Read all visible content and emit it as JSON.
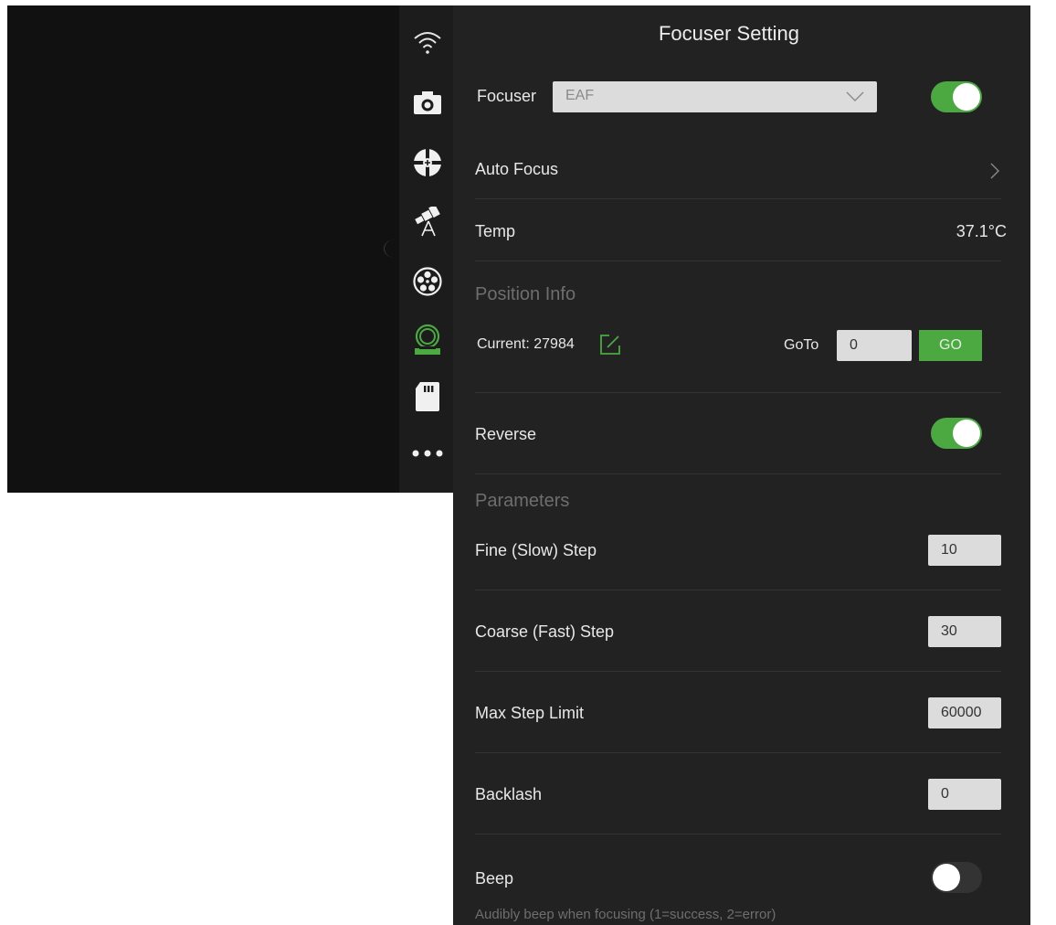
{
  "panel": {
    "title": "Focuser Setting",
    "focuser": {
      "label": "Focuser",
      "selected": "EAF",
      "enabled": true
    },
    "auto_focus": {
      "label": "Auto Focus"
    },
    "temp": {
      "label": "Temp",
      "value": "37.1°C"
    },
    "position_info": {
      "heading": "Position Info",
      "current": "Current: 27984",
      "goto_label": "GoTo",
      "goto_value": "0",
      "go_label": "GO"
    },
    "reverse": {
      "label": "Reverse",
      "enabled": true
    },
    "parameters": {
      "heading": "Parameters",
      "fine_step": {
        "label": "Fine (Slow) Step",
        "value": "10"
      },
      "coarse_step": {
        "label": "Coarse (Fast) Step",
        "value": "30"
      },
      "max_step": {
        "label": "Max Step Limit",
        "value": "60000"
      },
      "backlash": {
        "label": "Backlash",
        "value": "0"
      }
    },
    "beep": {
      "label": "Beep",
      "enabled": false,
      "description": "Audibly beep when focusing (1=success, 2=error)"
    }
  },
  "sidebar": {
    "items": [
      {
        "icon": "wifi-icon"
      },
      {
        "icon": "camera-icon"
      },
      {
        "icon": "guide-icon"
      },
      {
        "icon": "telescope-icon"
      },
      {
        "icon": "filter-wheel-icon"
      },
      {
        "icon": "focuser-icon",
        "active": true
      },
      {
        "icon": "sd-card-icon"
      },
      {
        "icon": "more-icon"
      }
    ]
  },
  "colors": {
    "accent": "#4ca942",
    "panel_bg": "#222222",
    "sidebar_bg": "#1c1c1c"
  }
}
